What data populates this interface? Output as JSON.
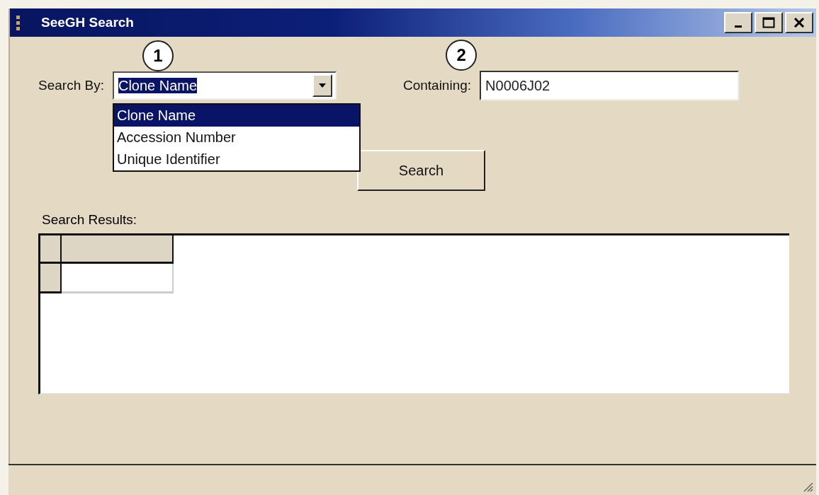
{
  "window": {
    "title": "SeeGH Search"
  },
  "callouts": [
    {
      "label": "1"
    },
    {
      "label": "2"
    }
  ],
  "search_by": {
    "label": "Search By:",
    "value": "Clone Name",
    "expanded": true,
    "options": [
      {
        "label": "Clone Name",
        "selected": true
      },
      {
        "label": "Accession Number",
        "selected": false
      },
      {
        "label": "Unique Identifier",
        "selected": false
      }
    ]
  },
  "containing": {
    "label": "Containing:",
    "value": "N0006J02"
  },
  "search_button": {
    "label": "Search"
  },
  "results": {
    "label": "Search Results:"
  }
}
